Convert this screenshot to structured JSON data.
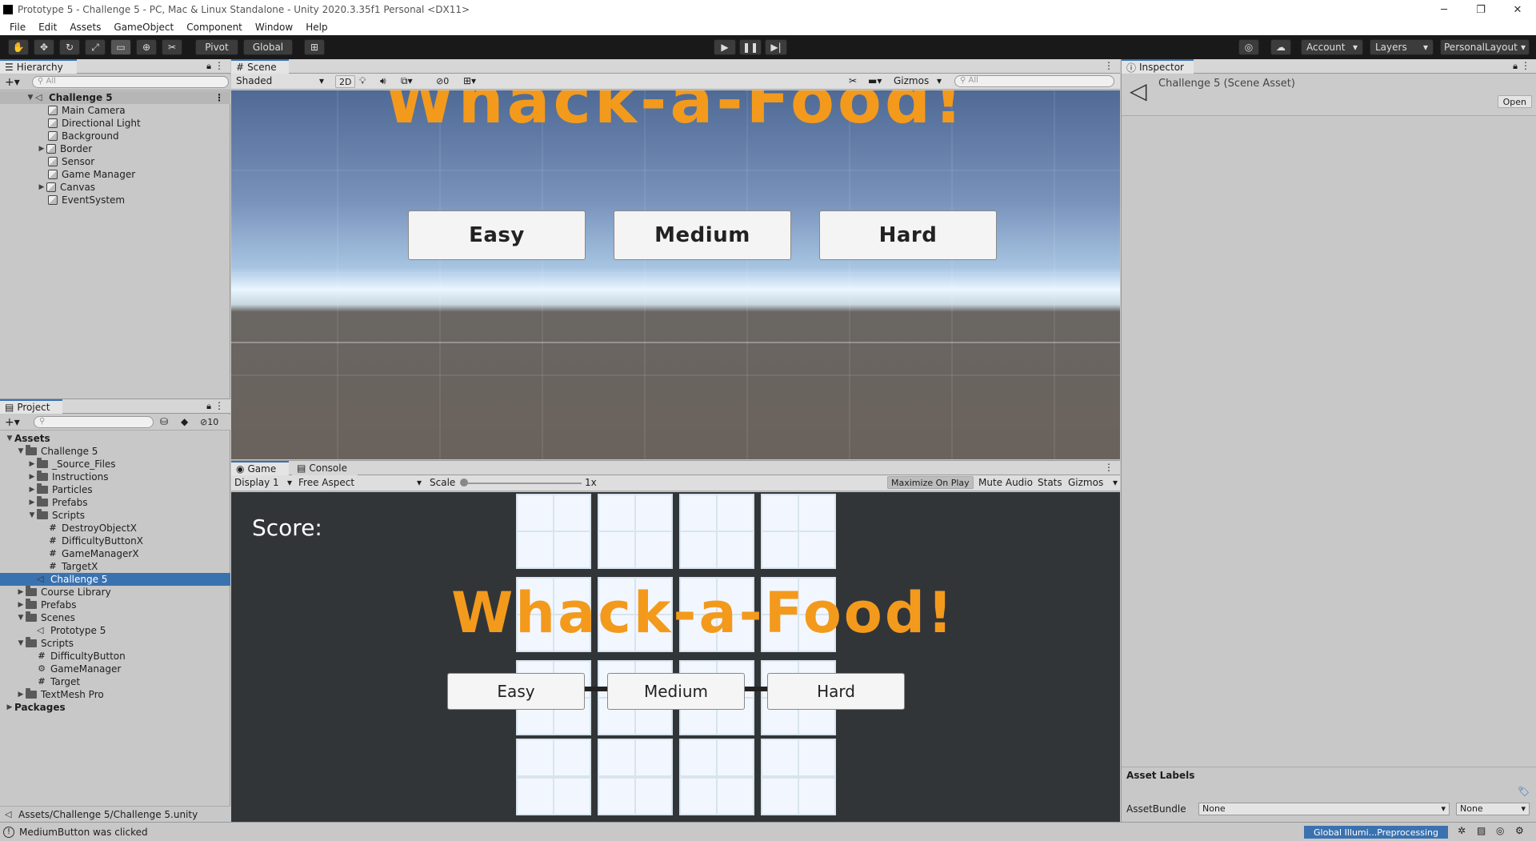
{
  "window": {
    "title": "Prototype 5 - Challenge 5 - PC, Mac & Linux Standalone - Unity 2020.3.35f1 Personal <DX11>"
  },
  "menu": [
    "File",
    "Edit",
    "Assets",
    "GameObject",
    "Component",
    "Window",
    "Help"
  ],
  "toolbar": {
    "pivot": "Pivot",
    "global": "Global",
    "account": "Account",
    "layers": "Layers",
    "layout": "PersonalLayout"
  },
  "hierarchy": {
    "tab": "Hierarchy",
    "search_placeholder": "All",
    "scene": "Challenge 5",
    "items": [
      "Main Camera",
      "Directional Light",
      "Background",
      "Border",
      "Sensor",
      "Game Manager",
      "Canvas",
      "EventSystem"
    ]
  },
  "scene_view": {
    "tab": "Scene",
    "shading": "Shaded",
    "mode_2d": "2D",
    "hidden_count": "0",
    "gizmos": "Gizmos",
    "search_placeholder": "All",
    "title_text": "Whack-a-Food!",
    "buttons": [
      "Easy",
      "Medium",
      "Hard"
    ]
  },
  "project": {
    "tab": "Project",
    "hidden_count": "10",
    "tree": [
      {
        "label": "Assets",
        "depth": 0,
        "kind": "root"
      },
      {
        "label": "Challenge 5",
        "depth": 1,
        "kind": "folder"
      },
      {
        "label": "_Source_Files",
        "depth": 2,
        "kind": "folder"
      },
      {
        "label": "Instructions",
        "depth": 2,
        "kind": "folder"
      },
      {
        "label": "Particles",
        "depth": 2,
        "kind": "folder"
      },
      {
        "label": "Prefabs",
        "depth": 2,
        "kind": "folder"
      },
      {
        "label": "Scripts",
        "depth": 2,
        "kind": "folder"
      },
      {
        "label": "DestroyObjectX",
        "depth": 3,
        "kind": "script"
      },
      {
        "label": "DifficultyButtonX",
        "depth": 3,
        "kind": "script"
      },
      {
        "label": "GameManagerX",
        "depth": 3,
        "kind": "script"
      },
      {
        "label": "TargetX",
        "depth": 3,
        "kind": "script"
      },
      {
        "label": "Challenge 5",
        "depth": 2,
        "kind": "scene"
      },
      {
        "label": "Course Library",
        "depth": 1,
        "kind": "folder"
      },
      {
        "label": "Prefabs",
        "depth": 1,
        "kind": "folder"
      },
      {
        "label": "Scenes",
        "depth": 1,
        "kind": "folder"
      },
      {
        "label": "Prototype 5",
        "depth": 2,
        "kind": "scene"
      },
      {
        "label": "Scripts",
        "depth": 1,
        "kind": "folder"
      },
      {
        "label": "DifficultyButton",
        "depth": 2,
        "kind": "script"
      },
      {
        "label": "GameManager",
        "depth": 2,
        "kind": "gear"
      },
      {
        "label": "Target",
        "depth": 2,
        "kind": "script"
      },
      {
        "label": "TextMesh Pro",
        "depth": 1,
        "kind": "folder"
      },
      {
        "label": "Packages",
        "depth": 0,
        "kind": "root"
      }
    ],
    "path": "Assets/Challenge 5/Challenge 5.unity"
  },
  "game_view": {
    "tab_game": "Game",
    "tab_console": "Console",
    "display": "Display 1",
    "aspect": "Free Aspect",
    "scale_label": "Scale",
    "scale_value": "1x",
    "maximize": "Maximize On Play",
    "mute": "Mute Audio",
    "stats": "Stats",
    "gizmos": "Gizmos",
    "score": "Score:",
    "title_text": "Whack-a-Food!",
    "buttons": [
      "Easy",
      "Medium",
      "Hard"
    ]
  },
  "inspector": {
    "tab": "Inspector",
    "asset_name": "Challenge 5 (Scene Asset)",
    "open_button": "Open",
    "asset_labels": "Asset Labels",
    "assetbundle_label": "AssetBundle",
    "assetbundle_value": "None",
    "variant_value": "None"
  },
  "status": {
    "message": "MediumButton was clicked",
    "progress": "Global Illumi...Preprocessing"
  },
  "colors": {
    "title_orange": "#f39a1c",
    "selection": "#3a72b0"
  }
}
